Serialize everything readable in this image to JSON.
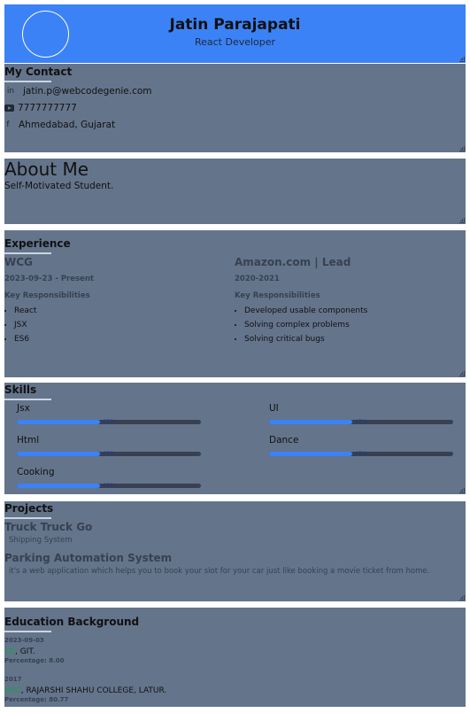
{
  "header": {
    "name": "Jatin Parajapati",
    "role": "React Developer",
    "background": "#3b82f6"
  },
  "contact": {
    "title": "My Contact",
    "items": [
      {
        "icon": "linkedin-icon",
        "glyph": "in",
        "text": "jatin.p@webcodegenie.com"
      },
      {
        "icon": "youtube-icon",
        "glyph": "",
        "text": "7777777777"
      },
      {
        "icon": "facebook-icon",
        "glyph": "f",
        "text": "Ahmedabad, Gujarat"
      }
    ]
  },
  "about": {
    "title": "About Me",
    "text": "Self-Motivated Student."
  },
  "experience": {
    "title": "Experience",
    "jobs": [
      {
        "company": "WCG",
        "dates": "2023-09-23 - Present",
        "resp_label": "Key Responsibilities",
        "items": [
          "React",
          "JSX",
          "ES6"
        ]
      },
      {
        "company": "Amazon.com | Lead",
        "dates": "2020-2021",
        "resp_label": "Key Responsibilities",
        "items": [
          "Developed usable components",
          "Solving complex problems",
          "Solving critical bugs"
        ]
      }
    ]
  },
  "skills": {
    "title": "Skills",
    "items": [
      {
        "name": "Jsx",
        "percent_label": "45%",
        "level": 0.45
      },
      {
        "name": "UI",
        "percent_label": "45%",
        "level": 0.45
      },
      {
        "name": "Html",
        "percent_label": "45%",
        "level": 0.45
      },
      {
        "name": "Dance",
        "percent_label": "45%",
        "level": 0.45
      },
      {
        "name": "Cooking",
        "percent_label": "45%",
        "level": 0.45
      }
    ]
  },
  "projects": {
    "title": "Projects",
    "items": [
      {
        "title": "Truck Truck Go",
        "desc": "Shipping System"
      },
      {
        "title": "Parking Automation System",
        "desc": "it's a web application which helps you to book your slot for your car just like booking a movie ticket from home."
      }
    ]
  },
  "education": {
    "title": "Education Background",
    "items": [
      {
        "date": "2023-09-03",
        "degree": "CE",
        "institute": ", GIT.",
        "percentage": "Percentage: 8.00"
      },
      {
        "date": "2017",
        "degree": "HSC",
        "institute": ", RAJARSHI SHAHU COLLEGE, LATUR.",
        "percentage": "Percentage: 80.77"
      }
    ]
  },
  "colors": {
    "panel": "#64748b",
    "accent": "#3b82f6",
    "track": "#374151"
  }
}
